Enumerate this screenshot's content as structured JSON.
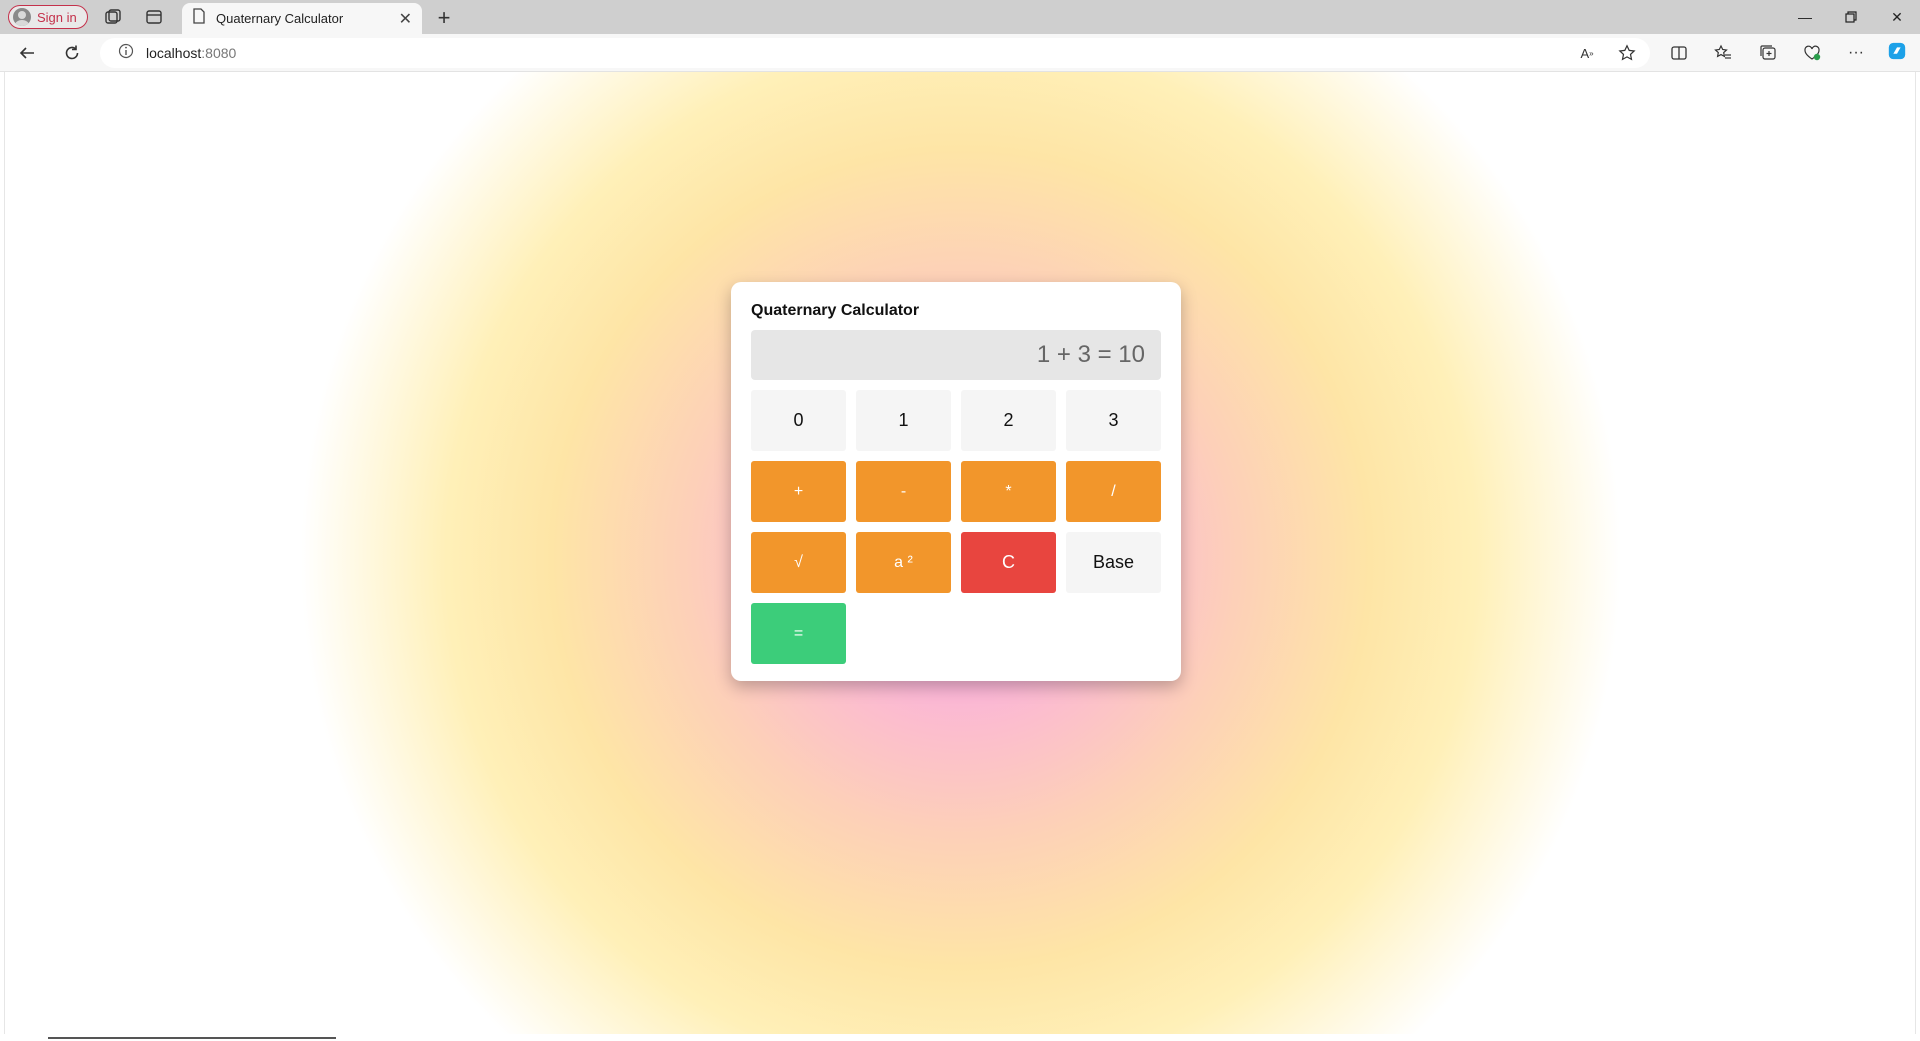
{
  "browser": {
    "profile_label": "Sign in",
    "tab_title": "Quaternary Calculator",
    "url_host": "localhost",
    "url_port": ":8080"
  },
  "calculator": {
    "title": "Quaternary Calculator",
    "display": "1 + 3 = 10",
    "digits": [
      "0",
      "1",
      "2",
      "3"
    ],
    "operators": [
      "+",
      "-",
      "*",
      "/"
    ],
    "functions": {
      "sqrt": "√",
      "square": "a ²",
      "clear": "C",
      "base": "Base",
      "equals": "="
    }
  },
  "colors": {
    "operator": "#f2962b",
    "clear": "#e8453f",
    "equals": "#3ccd7a",
    "digit": "#f5f5f5",
    "display_bg": "#e6e6e6"
  }
}
